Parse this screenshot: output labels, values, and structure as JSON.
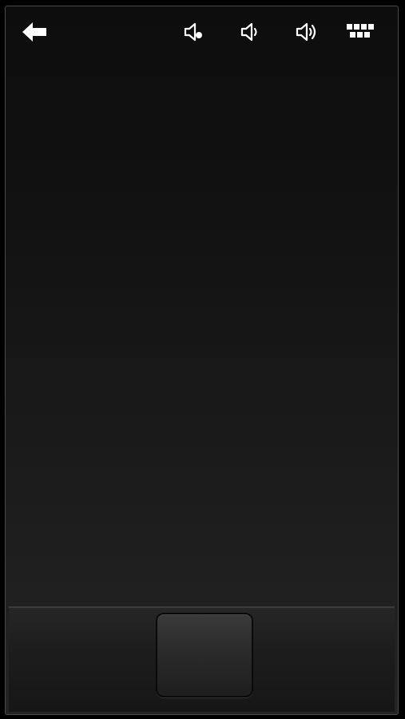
{
  "toolbar": {
    "back_icon": "arrow-left-icon",
    "mute_icon": "speaker-mute-icon",
    "volume_down_icon": "speaker-low-icon",
    "volume_up_icon": "speaker-high-icon",
    "keyboard_icon": "keyboard-icon"
  },
  "touchpad": {
    "area_name": "touchpad-area"
  },
  "mouse": {
    "click_button_icon": "mouse-click-button"
  },
  "colors": {
    "background_top": "#0d0d0d",
    "background_bottom": "#242424",
    "icon": "#ffffff",
    "frame_border": "#4a4a4a"
  }
}
